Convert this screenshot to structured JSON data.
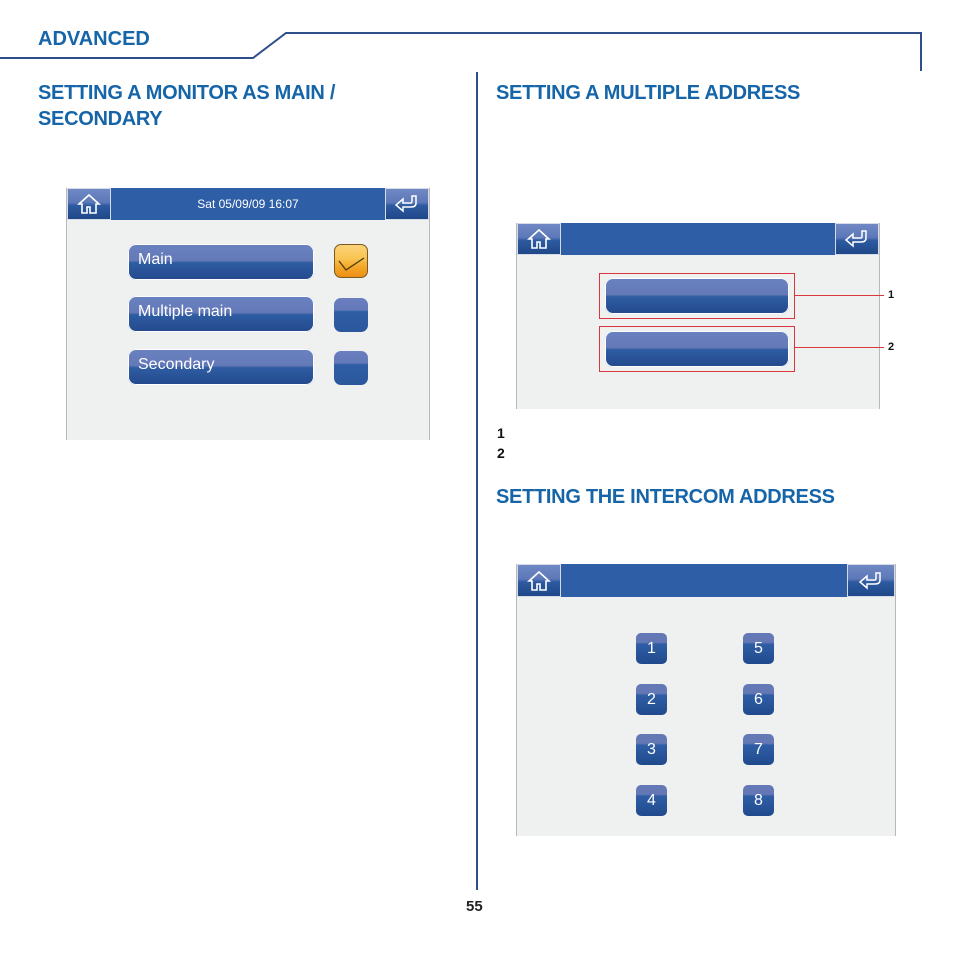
{
  "page": {
    "chapter": "ADVANCED",
    "page_number": "55",
    "accent_color": "#1565a8"
  },
  "left": {
    "heading": "SETTING A MONITOR AS MAIN / SECONDARY",
    "heading_line1": "SETTING A MONITOR AS MAIN /",
    "heading_line2": "SECONDARY",
    "screen": {
      "title": "Sat 05/09/09 16:07",
      "home_icon": "home-icon",
      "back_icon": "return-arrow-icon",
      "options": [
        {
          "label": "Main",
          "checked": true
        },
        {
          "label": "Multiple main",
          "checked": false
        },
        {
          "label": "Secondary",
          "checked": false
        }
      ]
    }
  },
  "right_top": {
    "heading": "SETTING A MULTIPLE ADDRESS",
    "screen": {
      "title": "",
      "home_icon": "home-icon",
      "back_icon": "return-arrow-icon",
      "buttons": [
        "",
        ""
      ],
      "callouts": [
        "1",
        "2"
      ]
    },
    "legend": [
      "1",
      "2"
    ]
  },
  "right_bottom": {
    "heading": "SETTING THE INTERCOM ADDRESS",
    "screen": {
      "title": "",
      "home_icon": "home-icon",
      "back_icon": "return-arrow-icon",
      "keys_left": [
        "1",
        "2",
        "3",
        "4"
      ],
      "keys_right": [
        "5",
        "6",
        "7",
        "8"
      ]
    }
  }
}
